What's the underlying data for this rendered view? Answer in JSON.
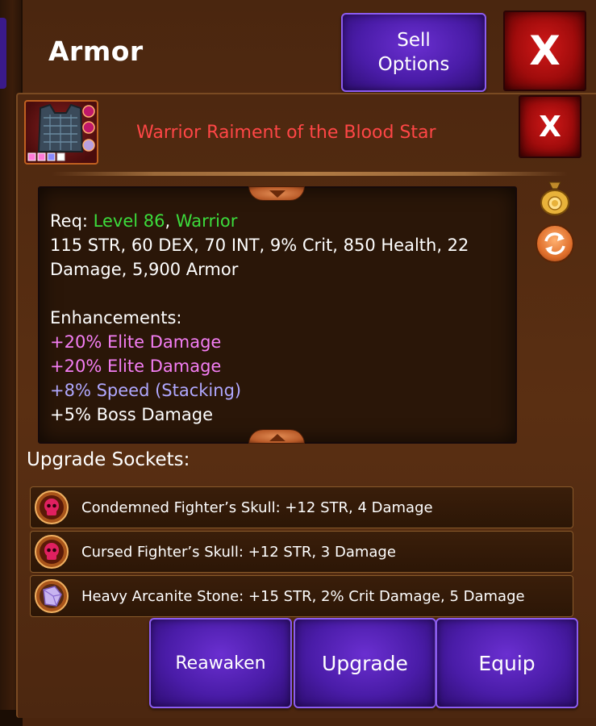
{
  "header": {
    "title": "Armor",
    "sell_line1": "Sell",
    "sell_line2": "Options",
    "close_label": "X"
  },
  "item": {
    "title": "Warrior Raiment of the Blood Star",
    "close_label": "X",
    "title_color": "#ff4646"
  },
  "stats": {
    "req_label": "Req:",
    "level": "Level 86",
    "comma": ",",
    "class": "Warrior",
    "line1": "115 STR, 60 DEX, 70 INT, 9% Crit, 850 Health, 22",
    "line2": "Damage, 5,900 Armor",
    "enhancements_label": "Enhancements:",
    "enhancements": [
      "+20% Elite Damage",
      "+20% Elite Damage",
      "+8% Speed (Stacking)",
      "+5% Boss Damage"
    ]
  },
  "sockets": {
    "title": "Upgrade Sockets:",
    "items": [
      {
        "icon": "red-skull-icon",
        "text": "Condemned Fighter’s Skull: +12 STR, 4 Damage"
      },
      {
        "icon": "red-skull-icon",
        "text": "Cursed Fighter’s Skull: +12 STR, 3 Damage"
      },
      {
        "icon": "purple-crystal-icon",
        "text": "Heavy Arcanite Stone: +15 STR, 2% Crit Damage, 5 Damage"
      }
    ]
  },
  "actions": {
    "reawaken": "Reawaken",
    "upgrade": "Upgrade",
    "equip": "Equip"
  },
  "colors": {
    "green": "#3cdc3c",
    "pink": "#f47ef4",
    "violet": "#b0a8ff",
    "purple_button": "#4a1ca8",
    "red_button": "#a00c0c"
  }
}
